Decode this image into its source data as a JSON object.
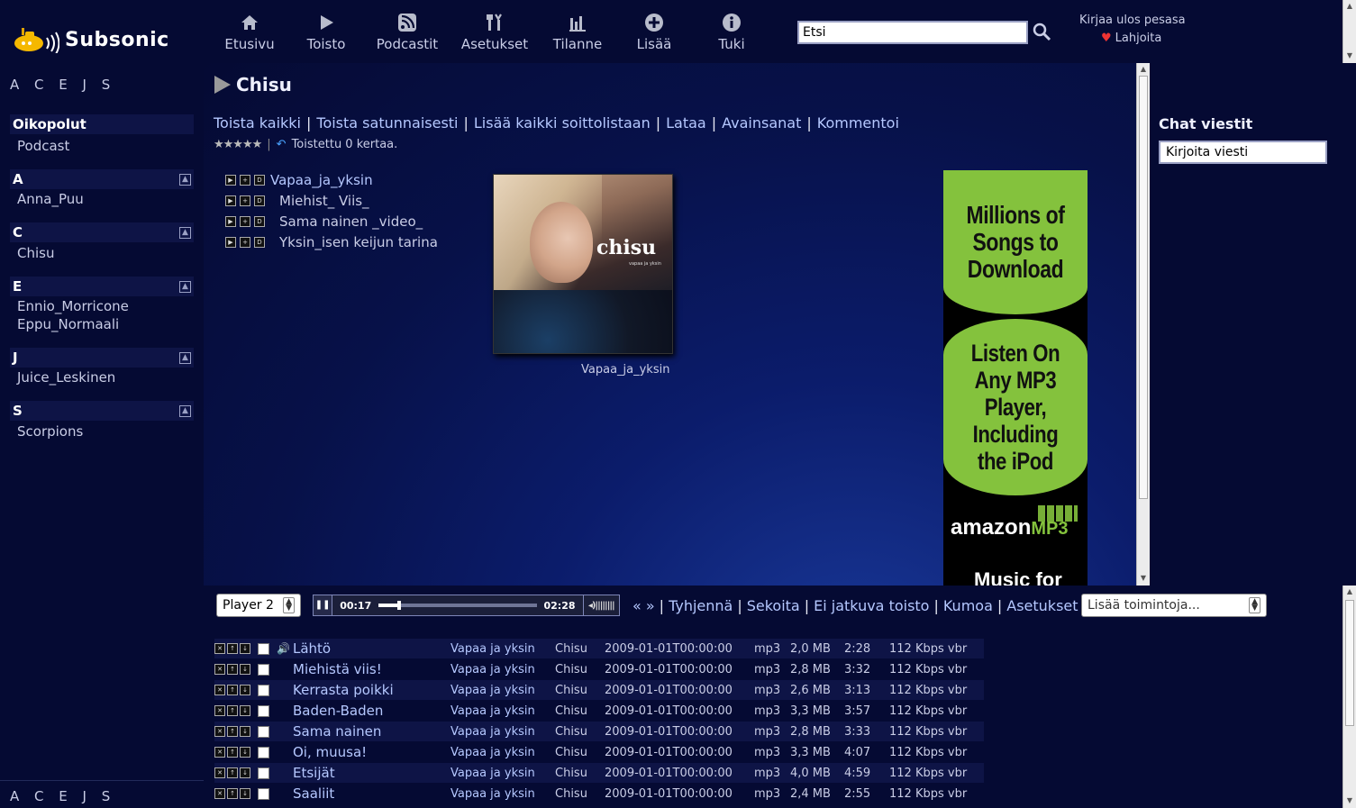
{
  "app": {
    "brand": "Subsonic"
  },
  "nav": [
    {
      "label": "Etusivu",
      "icon": "home-icon"
    },
    {
      "label": "Toisto",
      "icon": "play-icon"
    },
    {
      "label": "Podcastit",
      "icon": "rss-icon"
    },
    {
      "label": "Asetukset",
      "icon": "tools-icon"
    },
    {
      "label": "Tilanne",
      "icon": "chart-icon"
    },
    {
      "label": "Lisää",
      "icon": "plus-icon"
    },
    {
      "label": "Tuki",
      "icon": "info-icon"
    }
  ],
  "search": {
    "value": "Etsi"
  },
  "user": {
    "logout": "Kirjaa ulos pesasa",
    "donate": "Lahjoita"
  },
  "sidebar": {
    "letters": "A C E J S",
    "shortcuts_title": "Oikopolut",
    "shortcuts": [
      "Podcast"
    ],
    "groups": [
      {
        "letter": "A",
        "artists": [
          "Anna_Puu"
        ]
      },
      {
        "letter": "C",
        "artists": [
          "Chisu"
        ]
      },
      {
        "letter": "E",
        "artists": [
          "Ennio_Morricone",
          "Eppu_Normaali"
        ]
      },
      {
        "letter": "J",
        "artists": [
          "Juice_Leskinen"
        ]
      },
      {
        "letter": "S",
        "artists": [
          "Scorpions"
        ]
      }
    ]
  },
  "album": {
    "title": "Chisu",
    "actions": [
      "Toista kaikki",
      "Toista satunnaisesti",
      "Lisää kaikki soittolistaan",
      "Lataa",
      "Avainsanat",
      "Kommentoi"
    ],
    "stars": "★★★★★",
    "play_count": "Toistettu 0 kertaa.",
    "tracks": [
      "Vapaa_ja_yksin",
      "Miehist_ Viis_",
      "Sama nainen _video_",
      "Yksin_isen keijun tarina"
    ],
    "cover_caption": "Vapaa_ja_yksin",
    "cover_text": "chisu",
    "cover_subtext": "vapaa ja yksin"
  },
  "ad": {
    "line1": "Millions of Songs to Download",
    "line2": "Listen On Any MP3 Player, Including the iPod",
    "brand": "amazon",
    "brand_suffix": "MP3",
    "footer": "Music for"
  },
  "chat": {
    "title": "Chat viestit",
    "placeholder": "Kirjoita viesti"
  },
  "player": {
    "selected": "Player 2",
    "current_time": "00:17",
    "total_time": "02:28",
    "progress": 0.115,
    "actions": [
      "Tyhjennä",
      "Sekoita",
      "Ei jatkuva toisto",
      "Kumoa",
      "Asetukset"
    ],
    "more_actions": "Lisää toimintoja..."
  },
  "playlist": [
    {
      "title": "Lähtö",
      "album": "Vapaa ja yksin",
      "artist": "Chisu",
      "date": "2009-01-01T00:00:00",
      "format": "mp3",
      "size": "2,0 MB",
      "duration": "2:28",
      "bitrate": "112 Kbps vbr",
      "playing": true
    },
    {
      "title": "Miehistä viis!",
      "album": "Vapaa ja yksin",
      "artist": "Chisu",
      "date": "2009-01-01T00:00:00",
      "format": "mp3",
      "size": "2,8 MB",
      "duration": "3:32",
      "bitrate": "112 Kbps vbr"
    },
    {
      "title": "Kerrasta poikki",
      "album": "Vapaa ja yksin",
      "artist": "Chisu",
      "date": "2009-01-01T00:00:00",
      "format": "mp3",
      "size": "2,6 MB",
      "duration": "3:13",
      "bitrate": "112 Kbps vbr"
    },
    {
      "title": "Baden-Baden",
      "album": "Vapaa ja yksin",
      "artist": "Chisu",
      "date": "2009-01-01T00:00:00",
      "format": "mp3",
      "size": "3,3 MB",
      "duration": "3:57",
      "bitrate": "112 Kbps vbr"
    },
    {
      "title": "Sama nainen",
      "album": "Vapaa ja yksin",
      "artist": "Chisu",
      "date": "2009-01-01T00:00:00",
      "format": "mp3",
      "size": "2,8 MB",
      "duration": "3:33",
      "bitrate": "112 Kbps vbr"
    },
    {
      "title": "Oi, muusa!",
      "album": "Vapaa ja yksin",
      "artist": "Chisu",
      "date": "2009-01-01T00:00:00",
      "format": "mp3",
      "size": "3,3 MB",
      "duration": "4:07",
      "bitrate": "112 Kbps vbr"
    },
    {
      "title": "Etsijät",
      "album": "Vapaa ja yksin",
      "artist": "Chisu",
      "date": "2009-01-01T00:00:00",
      "format": "mp3",
      "size": "4,0 MB",
      "duration": "4:59",
      "bitrate": "112 Kbps vbr"
    },
    {
      "title": "Saaliit",
      "album": "Vapaa ja yksin",
      "artist": "Chisu",
      "date": "2009-01-01T00:00:00",
      "format": "mp3",
      "size": "2,4 MB",
      "duration": "2:55",
      "bitrate": "112 Kbps vbr"
    }
  ]
}
